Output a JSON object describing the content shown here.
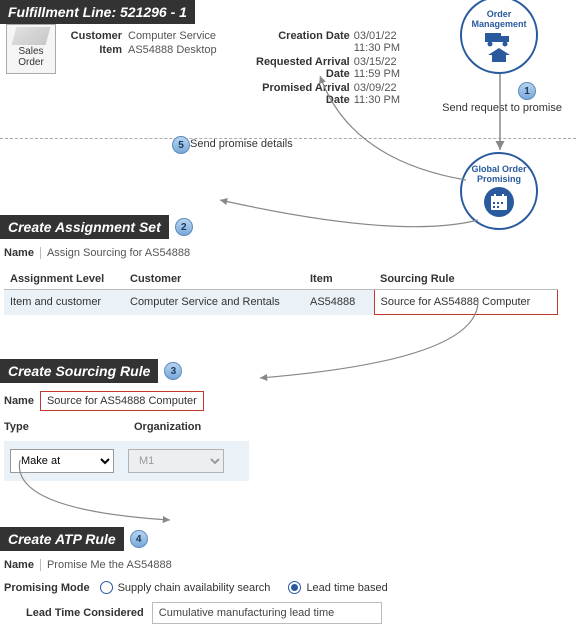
{
  "fulfillment": {
    "title": "Fulfillment Line: 521296 - 1",
    "sales_order_label": "Sales Order",
    "customer_label": "Customer",
    "customer_value": "Computer Service",
    "item_label": "Item",
    "item_value": "AS54888 Desktop",
    "creation_label": "Creation Date",
    "creation_value": "03/01/22 11:30 PM",
    "requested_label": "Requested Arrival Date",
    "requested_value": "03/15/22 11:59 PM",
    "promised_label": "Promised Arrival Date",
    "promised_value": "03/09/22 11:30 PM"
  },
  "badges": {
    "om": "Order Management",
    "gop": "Global Order Promising"
  },
  "flow": {
    "step1": "1",
    "step2": "2",
    "step3": "3",
    "step4": "4",
    "step5": "5",
    "send_request": "Send request to promise",
    "send_promise": "Send promise details"
  },
  "assignment": {
    "title": "Create Assignment Set",
    "name_label": "Name",
    "name_value": "Assign Sourcing for AS54888",
    "col_level": "Assignment Level",
    "col_customer": "Customer",
    "col_item": "Item",
    "col_rule": "Sourcing Rule",
    "row_level": "Item and customer",
    "row_customer": "Computer Service and Rentals",
    "row_item": "AS54888",
    "row_rule": "Source for AS54888 Computer"
  },
  "sourcing": {
    "title": "Create Sourcing Rule",
    "name_label": "Name",
    "name_value": "Source for AS54888 Computer",
    "type_label": "Type",
    "org_label": "Organization",
    "type_value": "Make at",
    "org_value": "M1"
  },
  "atp": {
    "title": "Create ATP Rule",
    "name_label": "Name",
    "name_value": "Promise Me the AS54888",
    "mode_label": "Promising Mode",
    "opt1": "Supply chain availability search",
    "opt2": "Lead time based",
    "lead_label": "Lead Time Considered",
    "lead_value": "Cumulative manufacturing lead time"
  }
}
